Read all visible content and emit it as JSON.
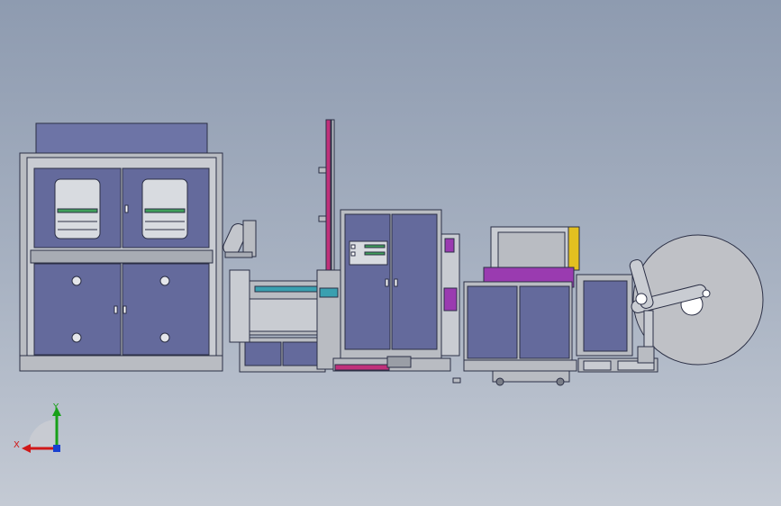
{
  "viewport": {
    "background_top": "#8e9bb0",
    "background_bottom": "#c4cad4",
    "part_fill": "#646a9c",
    "part_edge": "#2b2f45",
    "frame_fill": "#b9bcc2",
    "accent_magenta": "#c0307a",
    "accent_teal": "#3aa0b0",
    "accent_purple": "#9a3bb0",
    "accent_yellow": "#e3c020"
  },
  "triad": {
    "x_label": "X",
    "y_label": "Y",
    "x_color": "#d01818",
    "y_color": "#18a018",
    "z_color": "#1840d0"
  }
}
